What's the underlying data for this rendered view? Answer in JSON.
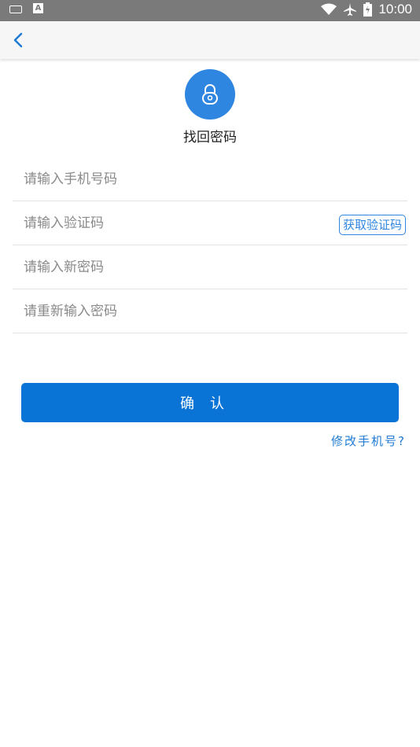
{
  "status_bar": {
    "time": "10:00",
    "left_icons": [
      "keyboard-icon",
      "a-icon"
    ],
    "right_icons": [
      "wifi-icon",
      "airplane-icon",
      "battery-icon"
    ]
  },
  "app_bar": {
    "back_icon": "chevron-left-icon"
  },
  "header": {
    "logo_icon": "lock-icon",
    "title": "找回密码"
  },
  "form": {
    "phone_placeholder": "请输入手机号码",
    "code_placeholder": "请输入验证码",
    "get_code_label": "获取验证码",
    "new_password_placeholder": "请输入新密码",
    "confirm_password_placeholder": "请重新输入密码"
  },
  "actions": {
    "confirm_label": "确认",
    "change_phone_label": "修改手机号?"
  },
  "colors": {
    "primary": "#0a74d6",
    "accent": "#2f86e0",
    "status_bar": "#7a7a7a"
  }
}
